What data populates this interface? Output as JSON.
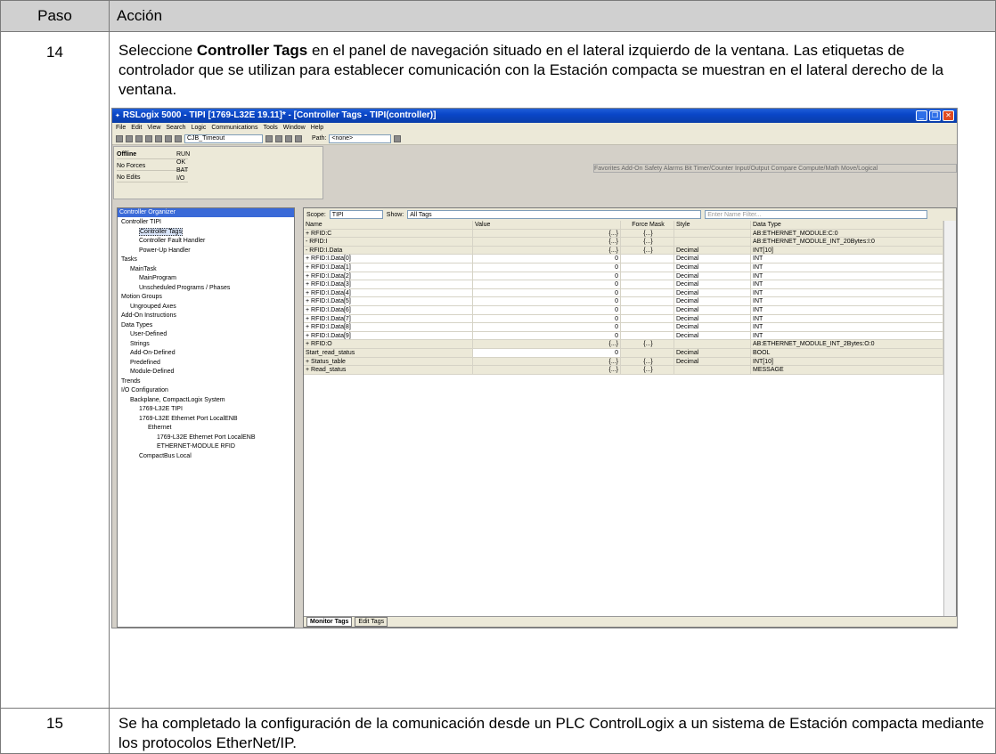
{
  "table": {
    "header": {
      "col1": "Paso",
      "col2": "Acción"
    },
    "rows": [
      {
        "step": "14",
        "text_before": "Seleccione ",
        "bold": "Controller Tags",
        "text_after": " en el panel de navegación situado en el lateral izquierdo de la ventana. Las etiquetas de controlador que se utilizan para establecer comunicación con la Estación compacta se muestran en el lateral derecho de la ventana."
      },
      {
        "step": "15",
        "text": "Se ha completado la configuración de la comunicación desde un PLC ControlLogix a un sistema de Estación compacta mediante los protocolos EtherNet/IP."
      }
    ]
  },
  "screenshot": {
    "title": "RSLogix 5000 - TIPI [1769-L32E 19.11]* - [Controller Tags - TIPI(controller)]",
    "menu": [
      "File",
      "Edit",
      "View",
      "Search",
      "Logic",
      "Communications",
      "Tools",
      "Window",
      "Help"
    ],
    "toolbar_combo": "CJB_Timeout",
    "path_label": "Path:",
    "path_value": "<none>",
    "status": {
      "offline": "Offline",
      "forces": "No Forces",
      "edits": "No Edits",
      "leds": [
        "RUN",
        "OK",
        "BAT",
        "I/O"
      ]
    },
    "instruction_tabs": "Favorites  Add-On  Safety  Alarms  Bit  Timer/Counter  Input/Output  Compare  Compute/Math  Move/Logical",
    "organizer": {
      "title": "Controller Organizer",
      "items": [
        "Controller TIPI",
        "Controller Tags",
        "Controller Fault Handler",
        "Power-Up Handler",
        "Tasks",
        "MainTask",
        "MainProgram",
        "Unscheduled Programs / Phases",
        "Motion Groups",
        "Ungrouped Axes",
        "Add-On Instructions",
        "Data Types",
        "User-Defined",
        "Strings",
        "Add-On-Defined",
        "Predefined",
        "Module-Defined",
        "Trends",
        "I/O Configuration",
        "Backplane, CompactLogix System",
        "1769-L32E TIPI",
        "1769-L32E Ethernet Port LocalENB",
        "Ethernet",
        "1769-L32E Ethernet Port LocalENB",
        "ETHERNET-MODULE RFID",
        "CompactBus Local"
      ]
    },
    "tags": {
      "scope_label": "Scope:",
      "scope_value": "TIPI",
      "show_label": "Show:",
      "show_value": "All Tags",
      "filter_placeholder": "Enter Name Filter...",
      "columns": [
        "Name",
        "Value",
        "Force Mask",
        "Style",
        "Data Type"
      ],
      "rows": [
        [
          "+ RFID:C",
          "{...}",
          "{...}",
          "",
          "AB:ETHERNET_MODULE:C:0"
        ],
        [
          "- RFID:I",
          "{...}",
          "{...}",
          "",
          "AB:ETHERNET_MODULE_INT_20Bytes:I:0"
        ],
        [
          "- RFID:I.Data",
          "{...}",
          "{...}",
          "Decimal",
          "INT[10]"
        ],
        [
          "+ RFID:I.Data[0]",
          "0",
          "",
          "Decimal",
          "INT"
        ],
        [
          "+ RFID:I.Data[1]",
          "0",
          "",
          "Decimal",
          "INT"
        ],
        [
          "+ RFID:I.Data[2]",
          "0",
          "",
          "Decimal",
          "INT"
        ],
        [
          "+ RFID:I.Data[3]",
          "0",
          "",
          "Decimal",
          "INT"
        ],
        [
          "+ RFID:I.Data[4]",
          "0",
          "",
          "Decimal",
          "INT"
        ],
        [
          "+ RFID:I.Data[5]",
          "0",
          "",
          "Decimal",
          "INT"
        ],
        [
          "+ RFID:I.Data[6]",
          "0",
          "",
          "Decimal",
          "INT"
        ],
        [
          "+ RFID:I.Data[7]",
          "0",
          "",
          "Decimal",
          "INT"
        ],
        [
          "+ RFID:I.Data[8]",
          "0",
          "",
          "Decimal",
          "INT"
        ],
        [
          "+ RFID:I.Data[9]",
          "0",
          "",
          "Decimal",
          "INT"
        ],
        [
          "+ RFID:O",
          "{...}",
          "{...}",
          "",
          "AB:ETHERNET_MODULE_INT_2Bytes:O:0"
        ],
        [
          "Start_read_status",
          "0",
          "",
          "Decimal",
          "BOOL"
        ],
        [
          "+ Status_table",
          "{...}",
          "{...}",
          "Decimal",
          "INT[10]"
        ],
        [
          "+ Read_status",
          "{...}",
          "{...}",
          "",
          "MESSAGE"
        ]
      ],
      "tab_active": "Monitor Tags",
      "tab_inactive": "Edit Tags"
    }
  }
}
